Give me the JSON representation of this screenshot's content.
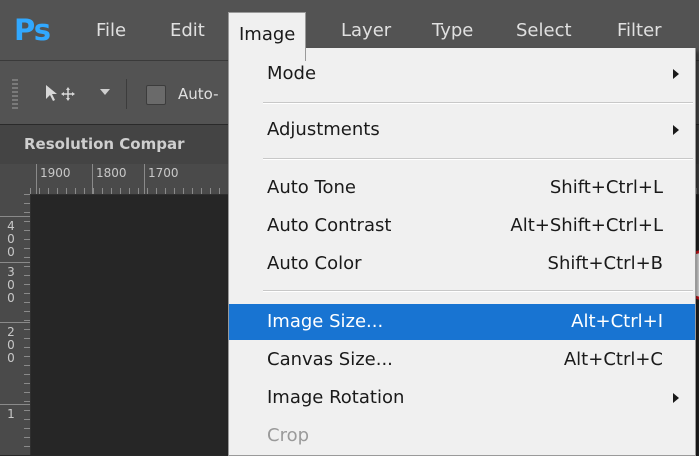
{
  "app": {
    "logo_text": "Ps",
    "accent_color": "#31a8ff"
  },
  "menubar": {
    "items": [
      {
        "label": "File"
      },
      {
        "label": "Edit"
      },
      {
        "label": "Image"
      },
      {
        "label": "Layer"
      },
      {
        "label": "Type"
      },
      {
        "label": "Select"
      },
      {
        "label": "Filter"
      }
    ],
    "active_item": "Image"
  },
  "options_bar": {
    "tool_icon": "move-tool-icon",
    "auto_select_label": "Auto-"
  },
  "document": {
    "tab_title": "Resolution Compar"
  },
  "rulers": {
    "top_labels": [
      "1900",
      "1800",
      "1700"
    ],
    "left_labels": [
      "400",
      "300",
      "200",
      "1"
    ]
  },
  "image_menu": {
    "items": [
      {
        "label": "Mode",
        "shortcut": "",
        "submenu": true
      },
      {
        "label": "Adjustments",
        "shortcut": "",
        "submenu": true
      },
      {
        "label": "Auto Tone",
        "shortcut": "Shift+Ctrl+L",
        "submenu": false
      },
      {
        "label": "Auto Contrast",
        "shortcut": "Alt+Shift+Ctrl+L",
        "submenu": false
      },
      {
        "label": "Auto Color",
        "shortcut": "Shift+Ctrl+B",
        "submenu": false
      },
      {
        "label": "Image Size...",
        "shortcut": "Alt+Ctrl+I",
        "submenu": false,
        "highlighted": true
      },
      {
        "label": "Canvas Size...",
        "shortcut": "Alt+Ctrl+C",
        "submenu": false
      },
      {
        "label": "Image Rotation",
        "shortcut": "",
        "submenu": true
      },
      {
        "label": "Crop",
        "shortcut": "",
        "submenu": false,
        "disabled": true
      }
    ],
    "highlight_color": "#1874d2"
  },
  "annotation": {
    "color": "#e8191f"
  }
}
